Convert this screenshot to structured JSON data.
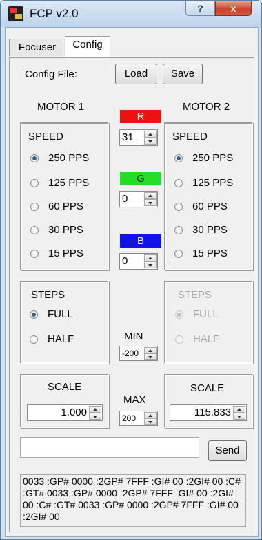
{
  "window": {
    "title": "FCP v2.0",
    "help_label": "?",
    "close_label": "x"
  },
  "tabs": [
    {
      "label": "Focuser"
    },
    {
      "label": "Config"
    }
  ],
  "config_file": {
    "label": "Config File:",
    "load_label": "Load",
    "save_label": "Save"
  },
  "motor1": {
    "title": "MOTOR 1",
    "speed_title": "SPEED",
    "speeds": [
      "250 PPS",
      "125 PPS",
      "60 PPS",
      "30 PPS",
      "15 PPS"
    ],
    "selected_speed": "250 PPS",
    "steps_title": "STEPS",
    "steps": [
      "FULL",
      "HALF"
    ],
    "selected_step": "FULL",
    "scale_title": "SCALE",
    "scale_value": "1.000"
  },
  "motor2": {
    "title": "MOTOR 2",
    "speed_title": "SPEED",
    "speeds": [
      "250 PPS",
      "125 PPS",
      "60 PPS",
      "30 PPS",
      "15 PPS"
    ],
    "selected_speed": "250 PPS",
    "steps_title": "STEPS",
    "steps": [
      "FULL",
      "HALF"
    ],
    "selected_step": "FULL",
    "steps_enabled": false,
    "scale_title": "SCALE",
    "scale_value": "115.833"
  },
  "rgb": {
    "r": {
      "label": "R",
      "value": "31",
      "color": "#ee1111"
    },
    "g": {
      "label": "G",
      "value": "0",
      "color": "#22dd22"
    },
    "b": {
      "label": "B",
      "value": "0",
      "color": "#1111ee"
    }
  },
  "min": {
    "label": "MIN",
    "value": "-200"
  },
  "max": {
    "label": "MAX",
    "value": "200"
  },
  "command": {
    "value": "",
    "send_label": "Send"
  },
  "log_text": "0033 :GP# 0000 :2GP# 7FFF :GI# 00 :2GI# 00 :C# :GT# 0033 :GP# 0000 :2GP# 7FFF :GI# 00 :2GI# 00 :C# :GT# 0033 :GP# 0000 :2GP# 7FFF :GI# 00 :2GI# 00",
  "icons": {
    "app": "fcp-app-icon",
    "spin": "spin-arrows-icon"
  },
  "colors": {
    "title_bar": "#c4d8ee",
    "close_button": "#c7432b",
    "radio_selected": "#2d5fa5"
  }
}
